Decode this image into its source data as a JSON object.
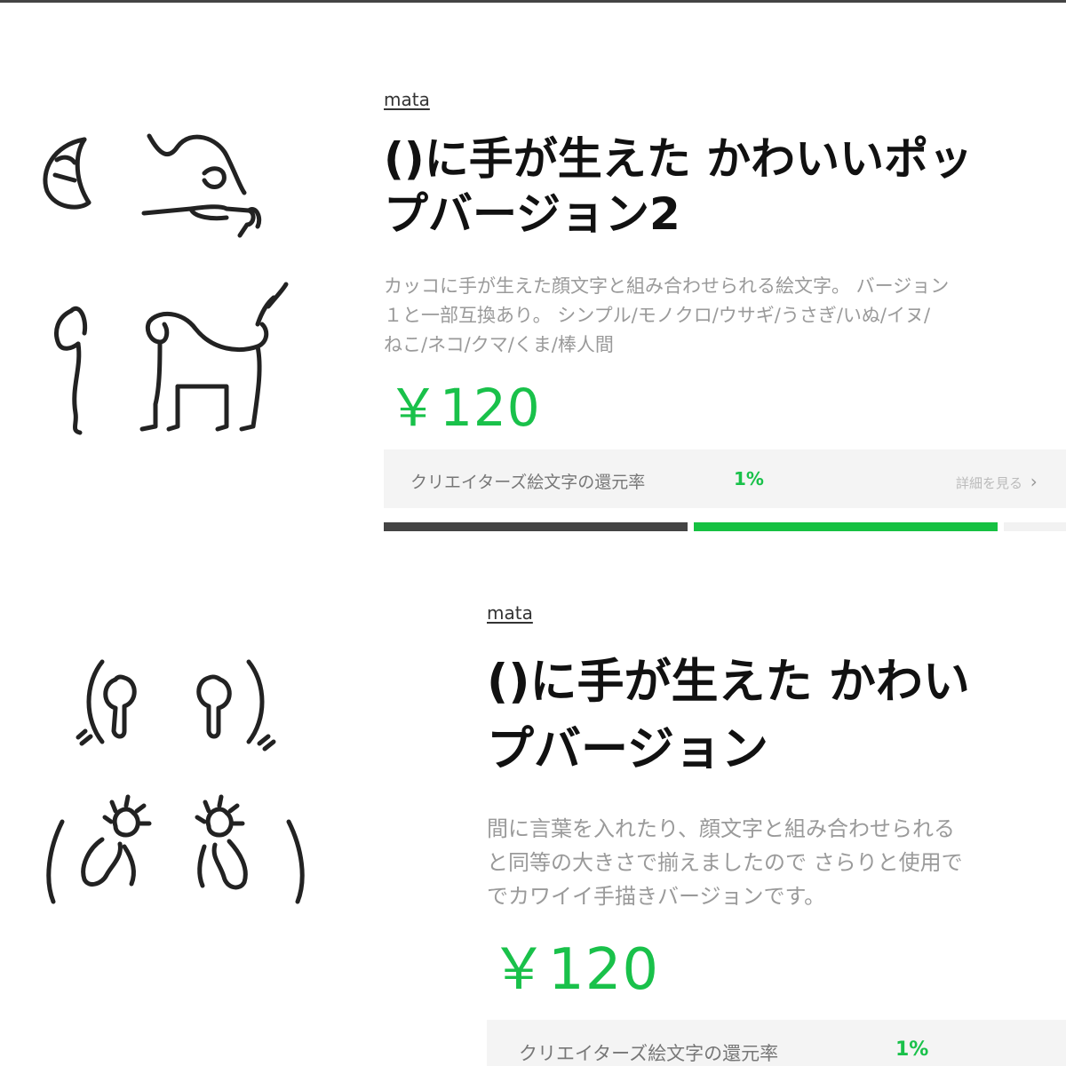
{
  "colors": {
    "price_green": "#19c14a",
    "rate_green": "#19c14a",
    "bar_dark": "#444444",
    "bar_green": "#16c142",
    "box_bg": "#f4f4f4"
  },
  "products": [
    {
      "author": "mata",
      "title_lines": [
        "()に手が生えた かわいいポッ",
        "プバージョン2"
      ],
      "description_lines": [
        "カッコに手が生えた顔文字と組み合わせられる絵文字。 バージョン",
        "１と一部互換あり。 シンプル/モノクロ/ウサギ/うさぎ/いぬ/イヌ/",
        "ねこ/ネコ/クマ/くま/棒人間"
      ],
      "price": "￥120",
      "creator_rate_label": "クリエイターズ絵文字の還元率",
      "creator_rate_value": "1%",
      "detail_link": "詳細を見る",
      "detail_chevron": "›",
      "artwork_icons": [
        "moon-face-icon",
        "bowing-figure-icon",
        "rabbit-head-icon",
        "dog-icon"
      ]
    },
    {
      "author": "mata",
      "title_lines": [
        "()に手が生えた かわい",
        "プバージョン"
      ],
      "description_lines": [
        "間に言葉を入れたり、顔文字と組み合わせられる",
        "と同等の大きさで揃えましたので さらりと使用で",
        "でカワイイ手描きバージョンです。"
      ],
      "price": "￥120",
      "creator_rate_label": "クリエイターズ絵文字の還元率",
      "creator_rate_value": "1%",
      "artwork_icons": [
        "open-parenthesis-hand-icon",
        "close-parenthesis-hand-icon",
        "waving-hand-left-icon",
        "waving-hand-right-icon"
      ]
    }
  ]
}
